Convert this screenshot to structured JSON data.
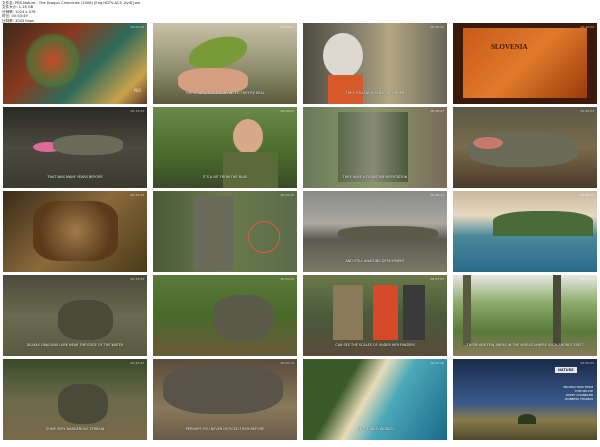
{
  "header": {
    "lines": [
      "文件名: PBS.Nature - The Dragon Chronicles (2008) [Eng.HDTV-AC3 .XviD].avi",
      "文件大小: 1.16 GB",
      "分辨率: 1024 x 576",
      "时长: 00:53:49",
      "比特率: 3043 kbps"
    ]
  },
  "thumbs": [
    {
      "id": "t1",
      "caption": "",
      "ts": "00:02:19"
    },
    {
      "id": "t2",
      "caption": "THE MORE WE ARE CONVINCED THEY'RE REAL",
      "ts": "00:04:57"
    },
    {
      "id": "t3",
      "caption": "THEY FOLLOW A SENSE OF ORDER",
      "ts": "00:08:33"
    },
    {
      "id": "t4",
      "caption": "",
      "ts": "00:10:59"
    },
    {
      "id": "t5",
      "caption": "THAT WAS MANY YEARS BEFORE",
      "ts": "00:13:25"
    },
    {
      "id": "t6",
      "caption": "IT'S A BIT FROM THE BLUE",
      "ts": "00:16:01"
    },
    {
      "id": "t7",
      "caption": "THEY HAVE A FEARSOME REPUTATION",
      "ts": "00:18:27"
    },
    {
      "id": "t8",
      "caption": "",
      "ts": "00:20:53"
    },
    {
      "id": "t9",
      "caption": "",
      "ts": "00:23:19"
    },
    {
      "id": "t10",
      "caption": "",
      "ts": "00:25:45"
    },
    {
      "id": "t11",
      "caption": "AND STILL AWAITING DEPLOYMENT",
      "ts": "00:28:11"
    },
    {
      "id": "t12",
      "caption": "",
      "ts": "00:30:37"
    },
    {
      "id": "t13",
      "caption": "DEADLY DRAGONS LURK NEAR THE EDGE OF THE WATER",
      "ts": "00:33:03"
    },
    {
      "id": "t14",
      "caption": "",
      "ts": "00:35:29"
    },
    {
      "id": "t15",
      "caption": "CAN SEE THE SCALES OF UNDER HER FINGERS",
      "ts": "00:37:55"
    },
    {
      "id": "t16",
      "caption": "THERE ARE FEW AREAS IN THE WORLD WHERE SUCH SHORES EXIST",
      "ts": "00:40:21"
    },
    {
      "id": "t17",
      "caption": "SOME VERY DANGEROUS TERRAIN",
      "ts": "00:42:47"
    },
    {
      "id": "t18",
      "caption": "PERHAPS YOU NEVER NOTICED THEM BEFORE",
      "ts": "00:45:13"
    },
    {
      "id": "t19",
      "caption": "IN THE WILD WORLD",
      "ts": "00:47:39"
    },
    {
      "id": "t20",
      "caption": "",
      "ts": "00:50:05"
    }
  ],
  "watermark": "PBS",
  "credits": {
    "title": "PRODUCTION TEAM",
    "names": [
      "TOM KELLYE",
      "POPPY CHANDLER",
      "ROBERTA THOMAS"
    ],
    "logo": "NATURE"
  },
  "map_label": "SLOVENIA"
}
